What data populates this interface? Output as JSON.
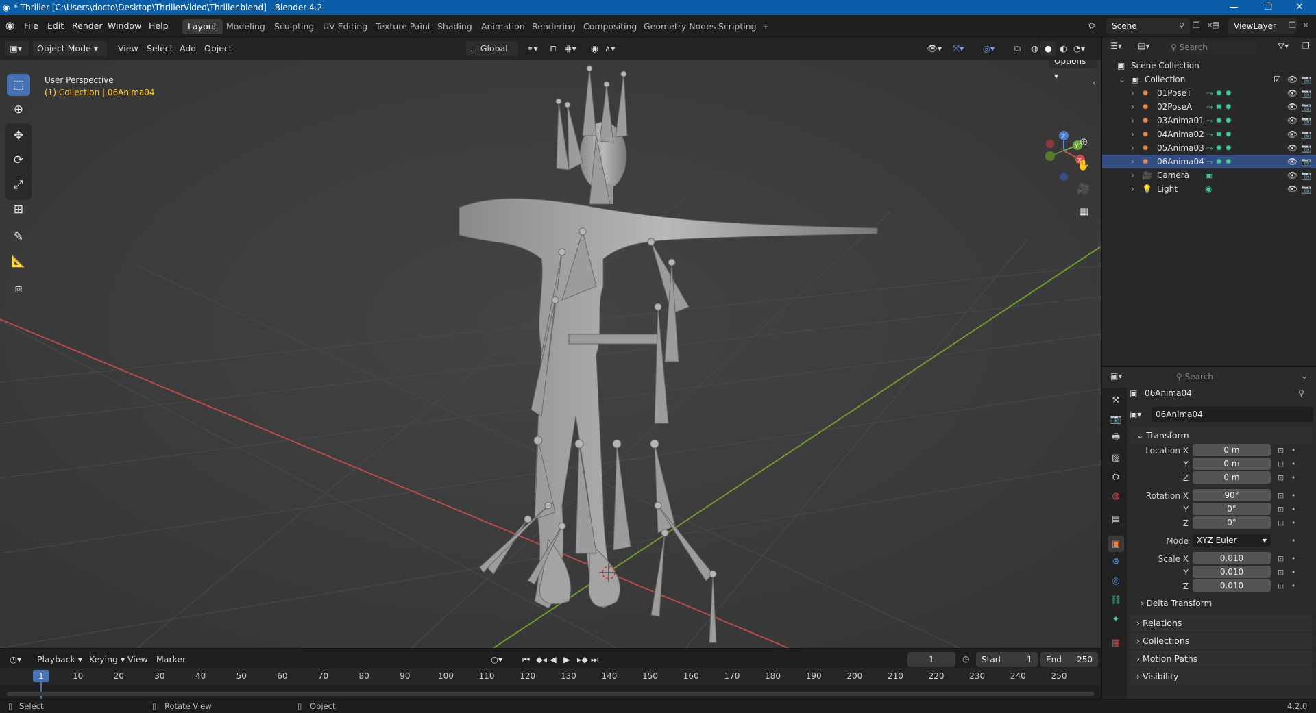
{
  "titlebar": {
    "title": "* Thriller [C:\\Users\\docto\\Desktop\\ThrillerVideo\\Thriller.blend] - Blender 4.2"
  },
  "menu": [
    "File",
    "Edit",
    "Render",
    "Window",
    "Help"
  ],
  "workspaces": [
    "Layout",
    "Modeling",
    "Sculpting",
    "UV Editing",
    "Texture Paint",
    "Shading",
    "Animation",
    "Rendering",
    "Compositing",
    "Geometry Nodes",
    "Scripting"
  ],
  "scene": {
    "name": "Scene",
    "view_layer": "ViewLayer"
  },
  "viewport_header": {
    "mode": "Object Mode",
    "view": "View",
    "select": "Select",
    "add": "Add",
    "object": "Object",
    "orientation": "Global",
    "options": "Options"
  },
  "viewport": {
    "perspective": "User Perspective",
    "context": "(1) Collection | 06Anima04"
  },
  "gizmo": {
    "z": "Z",
    "x": "X",
    "y": "Y"
  },
  "outliner": {
    "search_placeholder": "Search",
    "root": "Scene Collection",
    "collection": "Collection",
    "items": [
      {
        "name": "01PoseT",
        "icon": "armature-icon"
      },
      {
        "name": "02PoseA",
        "icon": "armature-icon"
      },
      {
        "name": "03Anima01",
        "icon": "armature-icon"
      },
      {
        "name": "04Anima02",
        "icon": "armature-icon"
      },
      {
        "name": "05Anima03",
        "icon": "armature-icon"
      },
      {
        "name": "06Anima04",
        "icon": "armature-icon"
      },
      {
        "name": "Camera",
        "icon": "camera-icon"
      },
      {
        "name": "Light",
        "icon": "light-icon"
      }
    ]
  },
  "properties": {
    "search_placeholder": "Search",
    "object_name": "06Anima04",
    "data_name": "06Anima04",
    "transform_label": "Transform",
    "location_label": "Location X",
    "rotation_label": "Rotation X",
    "scale_label": "Scale X",
    "y_label": "Y",
    "z_label": "Z",
    "mode_label": "Mode",
    "location": [
      "0 m",
      "0 m",
      "0 m"
    ],
    "rotation": [
      "90°",
      "0°",
      "0°"
    ],
    "mode": "XYZ Euler",
    "scale": [
      "0.010",
      "0.010",
      "0.010"
    ],
    "delta_transform": "Delta Transform",
    "panels": [
      "Relations",
      "Collections",
      "Motion Paths",
      "Visibility"
    ]
  },
  "timeline": {
    "playback": "Playback",
    "keying": "Keying",
    "view": "View",
    "marker": "Marker",
    "current_frame": "1",
    "start_label": "Start",
    "start": "1",
    "end_label": "End",
    "end": "250",
    "ticks": [
      "1",
      "10",
      "20",
      "30",
      "40",
      "50",
      "60",
      "70",
      "80",
      "90",
      "100",
      "110",
      "120",
      "130",
      "140",
      "150",
      "160",
      "170",
      "180",
      "190",
      "200",
      "210",
      "220",
      "230",
      "240",
      "250"
    ]
  },
  "statusbar": {
    "select": "Select",
    "rotate": "Rotate View",
    "object": "Object",
    "version": "4.2.0"
  },
  "colors": {
    "accent": "#4772b3",
    "titlebar": "#0a5ea8",
    "active_text": "#ffcc33",
    "x_axis": "#c44040",
    "y_axis": "#7aa030"
  }
}
